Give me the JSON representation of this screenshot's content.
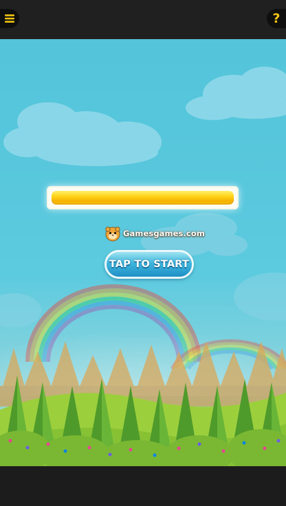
{
  "header": {
    "menu_icon": "hamburger-menu-icon",
    "help_label": "?"
  },
  "game": {
    "loading_progress": 1.0,
    "brand_text": "Gamesgames.com",
    "brand_icon": "hamster-mascot-icon",
    "start_label": "TAP TO START"
  },
  "colors": {
    "sky": "#5ccadf",
    "progress_fill": "#ffd319",
    "start_button": "#3fb6dc",
    "icon_accent": "#f1c40f",
    "bar": "#202020"
  }
}
